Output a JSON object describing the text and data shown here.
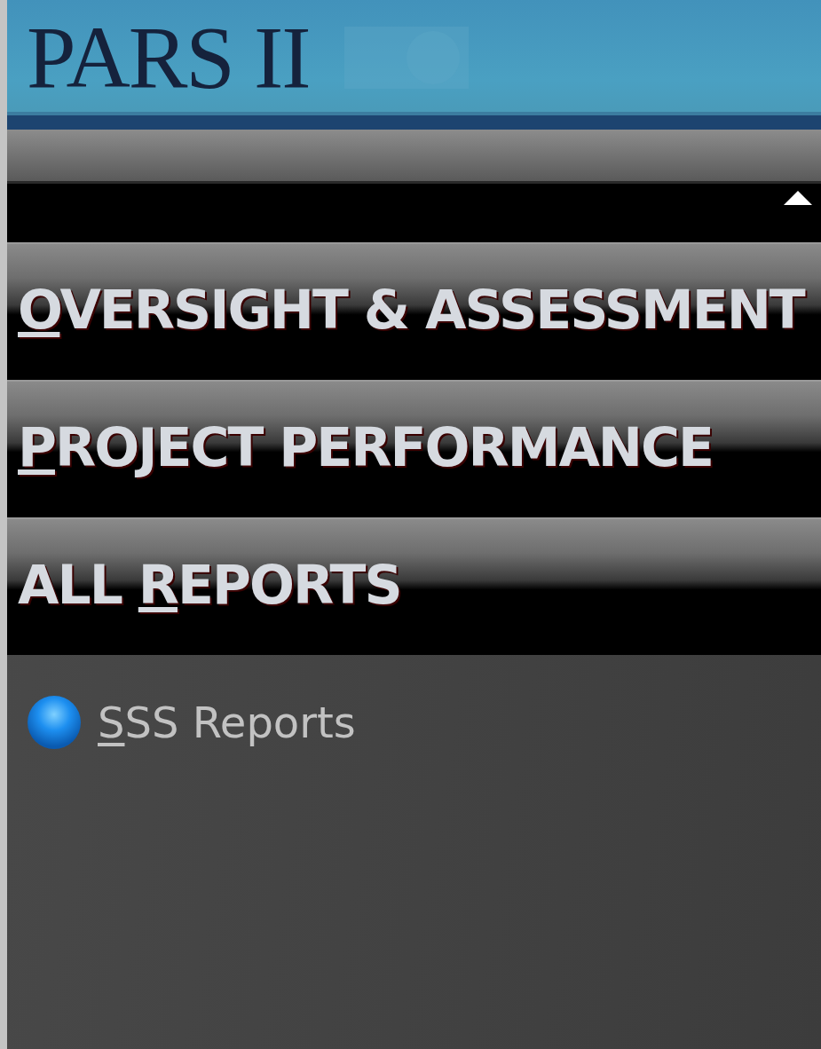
{
  "banner": {
    "title": "PARS II"
  },
  "panel": {
    "expanded": true
  },
  "sections": [
    {
      "key": "O",
      "after": "VERSIGHT & ASSESSMENT"
    },
    {
      "key": "P",
      "after": "ROJECT PERFORMANCE"
    },
    {
      "before": "ALL ",
      "key": "R",
      "after": "EPORTS"
    }
  ],
  "links": [
    {
      "key": "S",
      "after": "SS Reports"
    }
  ]
}
